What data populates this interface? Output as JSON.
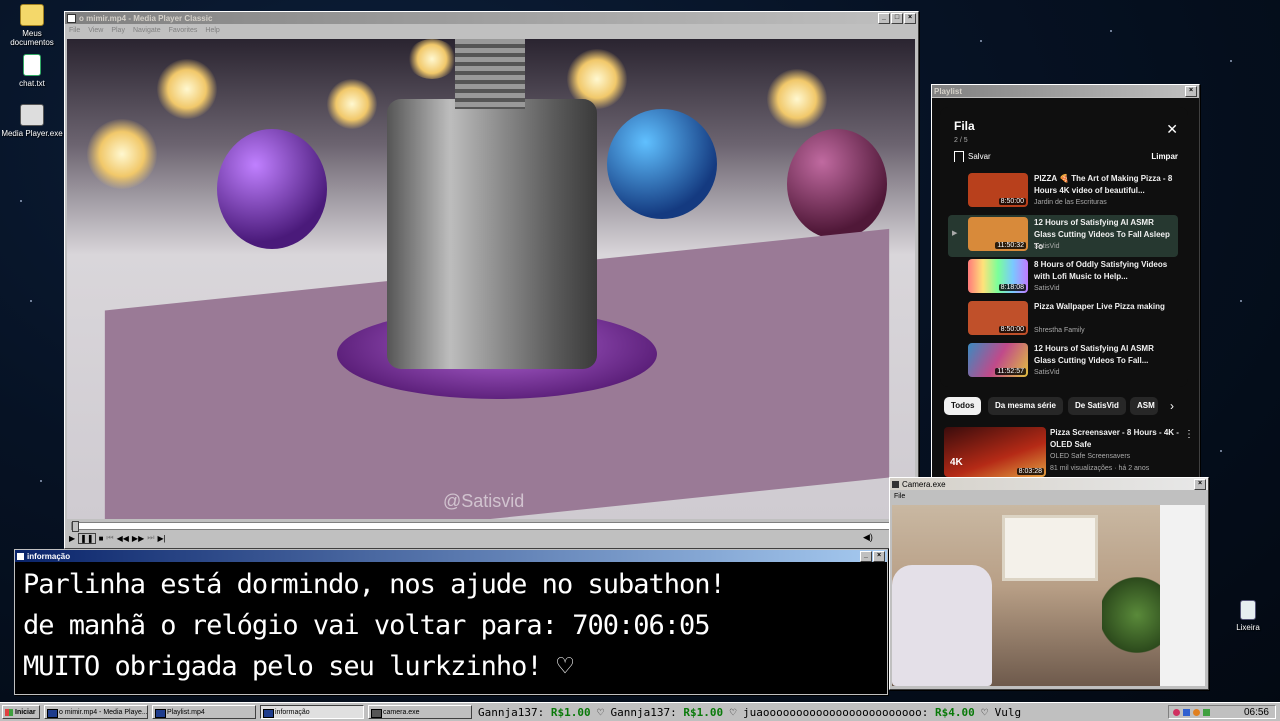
{
  "desktop": {
    "icons": [
      {
        "label": "Meus documentos",
        "icon": "folder-icon"
      },
      {
        "label": "chat.txt",
        "icon": "text-file-icon"
      },
      {
        "label": "Media Player.exe",
        "icon": "media-player-icon"
      },
      {
        "label": "Lixeira",
        "icon": "recycle-bin-icon"
      }
    ]
  },
  "player": {
    "title": "o mimir.mp4 - Media Player Classic",
    "menu": [
      "File",
      "View",
      "Play",
      "Navigate",
      "Favorites",
      "Help"
    ],
    "watermark": "@Satisvid",
    "progress": 0.003
  },
  "playlist_window": {
    "title": "Playlist",
    "queue_title": "Fila",
    "queue_position": "2 / 5",
    "save_label": "Salvar",
    "clear_label": "Limpar",
    "items": [
      {
        "title": "PIZZA 🍕 The Art of Making Pizza - 8 Hours 4K video of beautiful...",
        "channel": "Jardin de las Escrituras",
        "duration": "8:50:00",
        "thumb_color": "#b8401c",
        "active": false
      },
      {
        "title": "12 Hours of Satisfying AI ASMR Glass Cutting Videos To Fall Asleep To",
        "channel": "SatisVid",
        "duration": "11:50:32",
        "thumb_color": "#d88a3a",
        "active": true
      },
      {
        "title": "8 Hours of Oddly Satisfying Videos with Lofi Music to Help...",
        "channel": "SatisVid",
        "duration": "8:18:08",
        "thumb_color": "#9a6ad0",
        "active": false
      },
      {
        "title": "Pizza Wallpaper Live Pizza making",
        "channel": "Shrestha Family",
        "duration": "8:50:00",
        "thumb_color": "#c0502a",
        "active": false
      },
      {
        "title": "12 Hours of Satisfying AI ASMR Glass Cutting Videos To Fall...",
        "channel": "SatisVid",
        "duration": "11:52:57",
        "thumb_color": "#3a8ac0",
        "active": false
      }
    ],
    "chips": [
      "Todos",
      "Da mesma série",
      "De SatisVid",
      "ASM"
    ],
    "recommendation": {
      "title": "Pizza Screensaver - 8 Hours - 4K - OLED Safe",
      "channel": "OLED Safe Screensavers",
      "meta": "81 mil visualizações · há 2 anos",
      "duration": "8:03:28",
      "thumb_badge": "4K"
    }
  },
  "info_window": {
    "title": "informação",
    "line1": "Parlinha está dormindo, nos ajude no subathon!",
    "line2": "de manhã o relógio vai voltar para:  700:06:05",
    "line3": "MUITO obrigada pelo seu lurkzinho! ♡"
  },
  "camera_window": {
    "title": "Camera.exe",
    "menu": "File"
  },
  "taskbar": {
    "start_label": "Iniciar",
    "items": [
      "o mimir.mp4 - Media Playe...",
      "Playlist.mp4",
      "informação",
      "camera.exe"
    ],
    "ticker": [
      {
        "user": "Gannja137:",
        "amount": "R$1.00"
      },
      {
        "user": "Gannja137:",
        "amount": "R$1.00"
      },
      {
        "user": "juaoooooooooooooooooooooooo:",
        "amount": "R$4.00"
      },
      {
        "user": "Vulg",
        "amount": ""
      }
    ],
    "clock": "06:56"
  },
  "colors": {
    "titlebar_active": "#0a246a",
    "titlebar_gradient_end": "#a6caf0",
    "money_green": "#0a7a0a",
    "youtube_dark": "#0f0f0f"
  }
}
